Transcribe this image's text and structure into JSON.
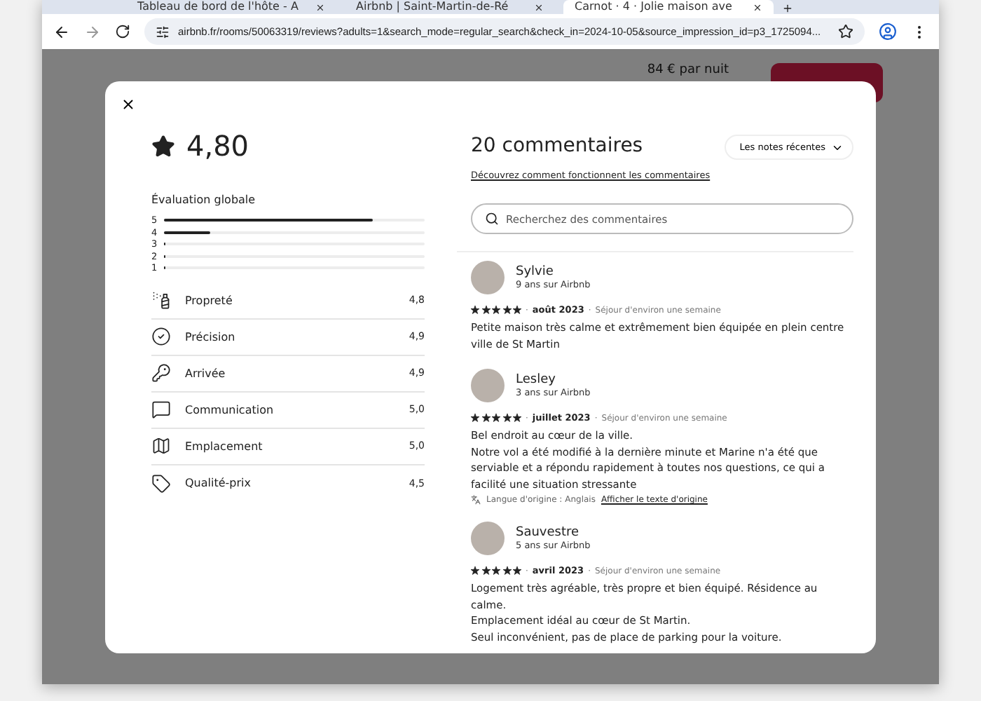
{
  "browser": {
    "tabs": [
      {
        "title": "Tableau de bord de l'hôte - A",
        "selected": false
      },
      {
        "title": "Airbnb | Saint-Martin-de-Ré",
        "selected": false
      },
      {
        "title": "Carnot · 4 · Jolie maison ave",
        "selected": true
      }
    ],
    "url": "airbnb.fr/rooms/50063319/reviews?adults=1&search_mode=regular_search&check_in=2024-10-05&source_impression_id=p3_1725094..."
  },
  "background_page": {
    "price": "84 € par nuit"
  },
  "modal": {
    "rating": "4,80",
    "overall_label": "Évaluation globale",
    "distribution": [
      {
        "label": "5",
        "level": 0.8
      },
      {
        "label": "4",
        "level": 0.18
      },
      {
        "label": "3",
        "level": 0
      },
      {
        "label": "2",
        "level": 0
      },
      {
        "label": "1",
        "level": 0
      }
    ],
    "categories": [
      {
        "kind": "cleanliness",
        "label": "Propreté",
        "score": "4,8"
      },
      {
        "kind": "accuracy",
        "label": "Précision",
        "score": "4,9"
      },
      {
        "kind": "checkin",
        "label": "Arrivée",
        "score": "4,9"
      },
      {
        "kind": "communication",
        "label": "Communication",
        "score": "5,0"
      },
      {
        "kind": "location",
        "label": "Emplacement",
        "score": "5,0"
      },
      {
        "kind": "value",
        "label": "Qualité-prix",
        "score": "4,5"
      }
    ],
    "title": "20 commentaires",
    "help_link": "Découvrez comment fonctionnent les commentaires",
    "sort": "Les notes récentes",
    "search": {
      "placeholder": "Recherchez des commentaires"
    },
    "meta_separator": "·",
    "reviews": [
      {
        "name": "Sylvie",
        "tenure": "9 ans sur Airbnb",
        "stars": 5,
        "date": "août 2023",
        "stay": "Séjour d'environ une semaine",
        "text": [
          "Petite maison très calme et extrêmement bien équipée en plein centre ville de St Martin"
        ]
      },
      {
        "name": "Lesley",
        "tenure": "3 ans sur Airbnb",
        "stars": 5,
        "date": "juillet 2023",
        "stay": "Séjour d'environ une semaine",
        "text": [
          "Bel endroit au cœur de la ville.",
          "Notre vol a été modifié à la dernière minute et Marine n'a été que serviable et a répondu rapidement à toutes nos questions, ce qui a facilité une situation stressante"
        ],
        "translation": {
          "note": "Langue d'origine : Anglais",
          "link": "Afficher le texte d'origine"
        }
      },
      {
        "name": "Sauvestre",
        "tenure": "5 ans sur Airbnb",
        "stars": 5,
        "date": "avril 2023",
        "stay": "Séjour d'environ une semaine",
        "text": [
          "Logement très agréable, très propre et bien équipé. Résidence au calme.",
          "Emplacement idéal au cœur de St Martin.",
          "Seul inconvénient, pas de place de parking pour la voiture."
        ]
      }
    ]
  }
}
